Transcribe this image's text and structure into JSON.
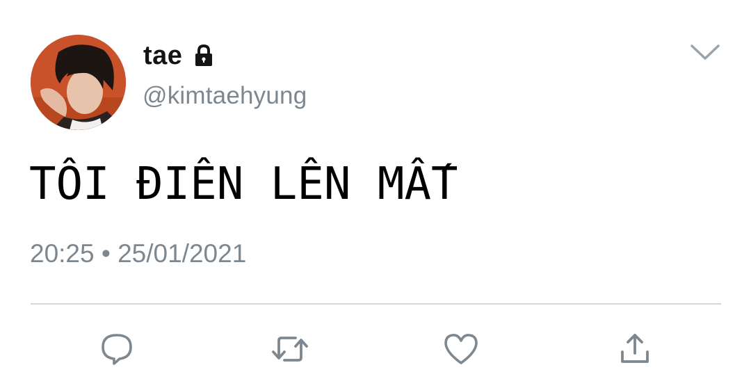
{
  "tweet": {
    "display_name": "tae",
    "handle": "@kimtaehyung",
    "protected_icon": "lock-icon",
    "text": "TÔI ĐIÊN LÊN MẤT",
    "timestamp": "20:25 • 25/01/2021",
    "menu_icon": "chevron-down-icon"
  },
  "actions": [
    {
      "name": "reply",
      "icon": "speech-bubble-icon"
    },
    {
      "name": "retweet",
      "icon": "retweet-arrows-icon"
    },
    {
      "name": "like",
      "icon": "heart-icon"
    },
    {
      "name": "share",
      "icon": "share-arrow-icon"
    }
  ],
  "colors": {
    "text": "#141414",
    "secondary": "#7d8790",
    "icon": "#7d8790",
    "divider": "#d3d7db",
    "background": "#ffffff"
  }
}
